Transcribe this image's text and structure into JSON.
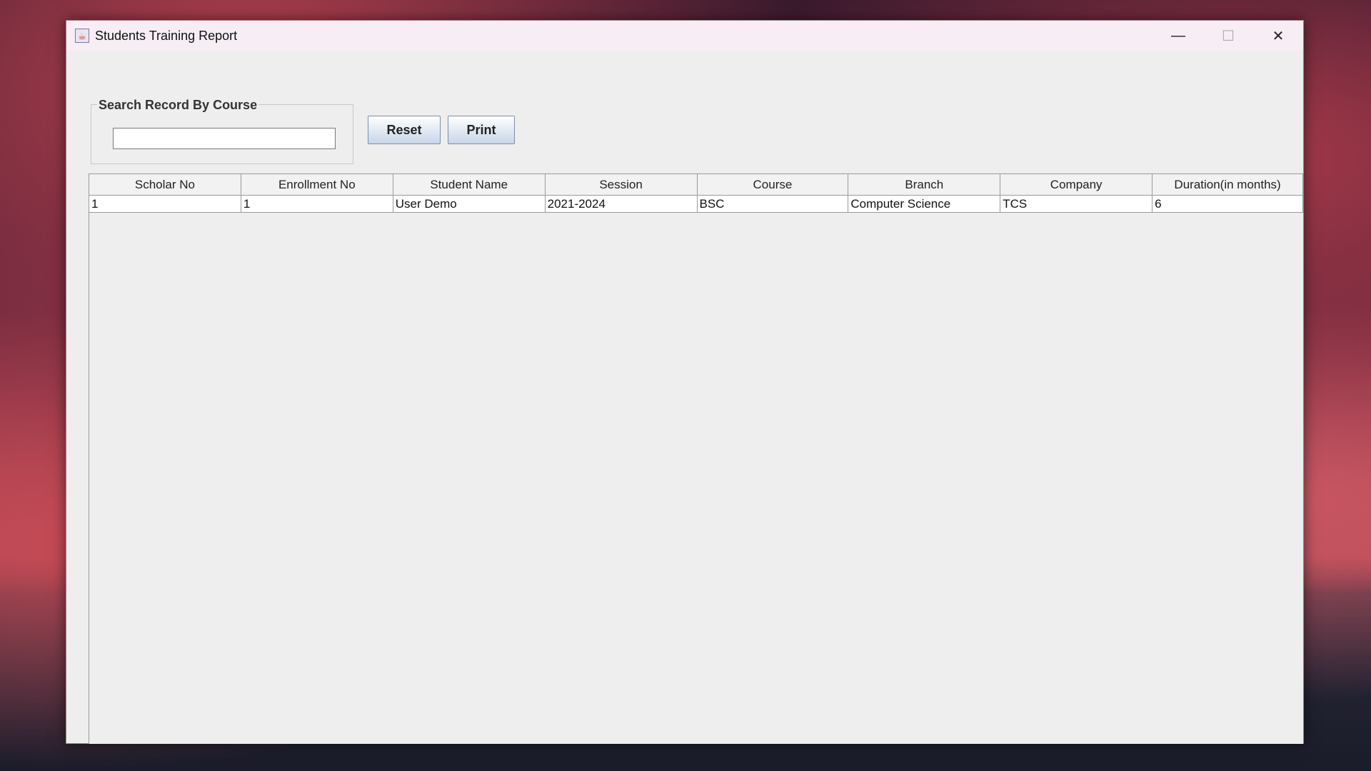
{
  "window": {
    "title": "Students Training Report",
    "controls": {
      "minimize": "—",
      "maximize": "☐",
      "close": "✕"
    }
  },
  "search": {
    "legend": "Search Record By Course",
    "value": "",
    "placeholder": ""
  },
  "buttons": {
    "reset": "Reset",
    "print": "Print"
  },
  "table": {
    "columns": [
      "Scholar No",
      "Enrollment No",
      "Student Name",
      "Session",
      "Course",
      "Branch",
      "Company",
      "Duration(in months)"
    ],
    "rows": [
      [
        "1",
        "1",
        "User Demo",
        "2021-2024",
        "BSC",
        "Computer Science",
        "TCS",
        "6"
      ]
    ]
  }
}
